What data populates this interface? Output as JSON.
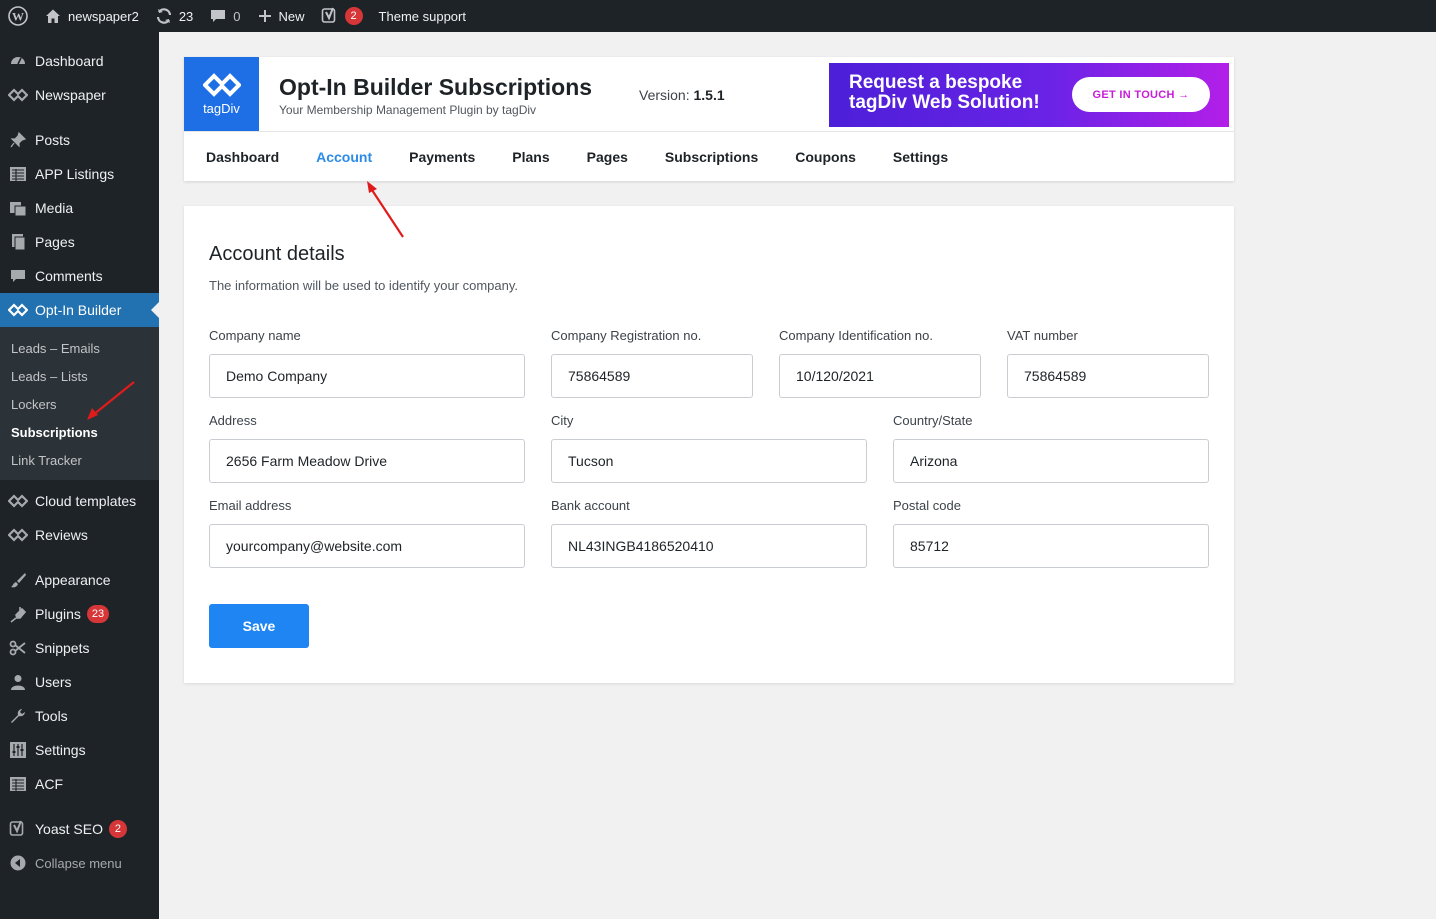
{
  "adminbar": {
    "site_name": "newspaper2",
    "updates_count": "23",
    "comments_count": "0",
    "new_label": "New",
    "yoast_badge": "2",
    "theme_support": "Theme support"
  },
  "sidebar": {
    "items": {
      "dashboard": "Dashboard",
      "newspaper": "Newspaper",
      "posts": "Posts",
      "app_listings": "APP Listings",
      "media": "Media",
      "pages": "Pages",
      "comments": "Comments",
      "optin_builder": "Opt-In Builder",
      "cloud_templates": "Cloud templates",
      "reviews": "Reviews",
      "appearance": "Appearance",
      "plugins": "Plugins",
      "plugins_badge": "23",
      "snippets": "Snippets",
      "users": "Users",
      "tools": "Tools",
      "settings": "Settings",
      "acf": "ACF",
      "yoast": "Yoast SEO",
      "yoast_badge": "2",
      "collapse": "Collapse menu"
    },
    "submenu": {
      "leads_emails": "Leads – Emails",
      "leads_lists": "Leads – Lists",
      "lockers": "Lockers",
      "subscriptions": "Subscriptions",
      "link_tracker": "Link Tracker"
    }
  },
  "header": {
    "logo_text": "tagDiv",
    "title": "Opt-In Builder Subscriptions",
    "subtitle": "Your Membership Management Plugin by tagDiv",
    "version_label": "Version:",
    "version_value": "1.5.1",
    "promo_line1": "Request a bespoke",
    "promo_line2": "tagDiv Web Solution!",
    "promo_button": "GET IN TOUCH  →"
  },
  "tabs": {
    "dashboard": "Dashboard",
    "account": "Account",
    "payments": "Payments",
    "plans": "Plans",
    "pages": "Pages",
    "subscriptions": "Subscriptions",
    "coupons": "Coupons",
    "settings": "Settings"
  },
  "account": {
    "title": "Account details",
    "description": "The information will be used to identify your company.",
    "fields": {
      "company_name": {
        "label": "Company name",
        "value": "Demo Company"
      },
      "company_reg": {
        "label": "Company Registration no.",
        "value": "75864589"
      },
      "company_id": {
        "label": "Company Identification no.",
        "value": "10/120/2021"
      },
      "vat": {
        "label": "VAT number",
        "value": "75864589"
      },
      "address": {
        "label": "Address",
        "value": "2656 Farm Meadow Drive"
      },
      "city": {
        "label": "City",
        "value": "Tucson"
      },
      "country": {
        "label": "Country/State",
        "value": "Arizona"
      },
      "email": {
        "label": "Email address",
        "value": "yourcompany@website.com"
      },
      "bank": {
        "label": "Bank account",
        "value": "NL43INGB4186520410"
      },
      "postal": {
        "label": "Postal code",
        "value": "85712"
      }
    },
    "save_label": "Save"
  },
  "colors": {
    "admin_dark": "#1d2327",
    "wp_blue": "#2271b1",
    "tab_active": "#2b8be8",
    "save_button": "#1e85f2",
    "annotation_arrow": "#e01b1b"
  }
}
